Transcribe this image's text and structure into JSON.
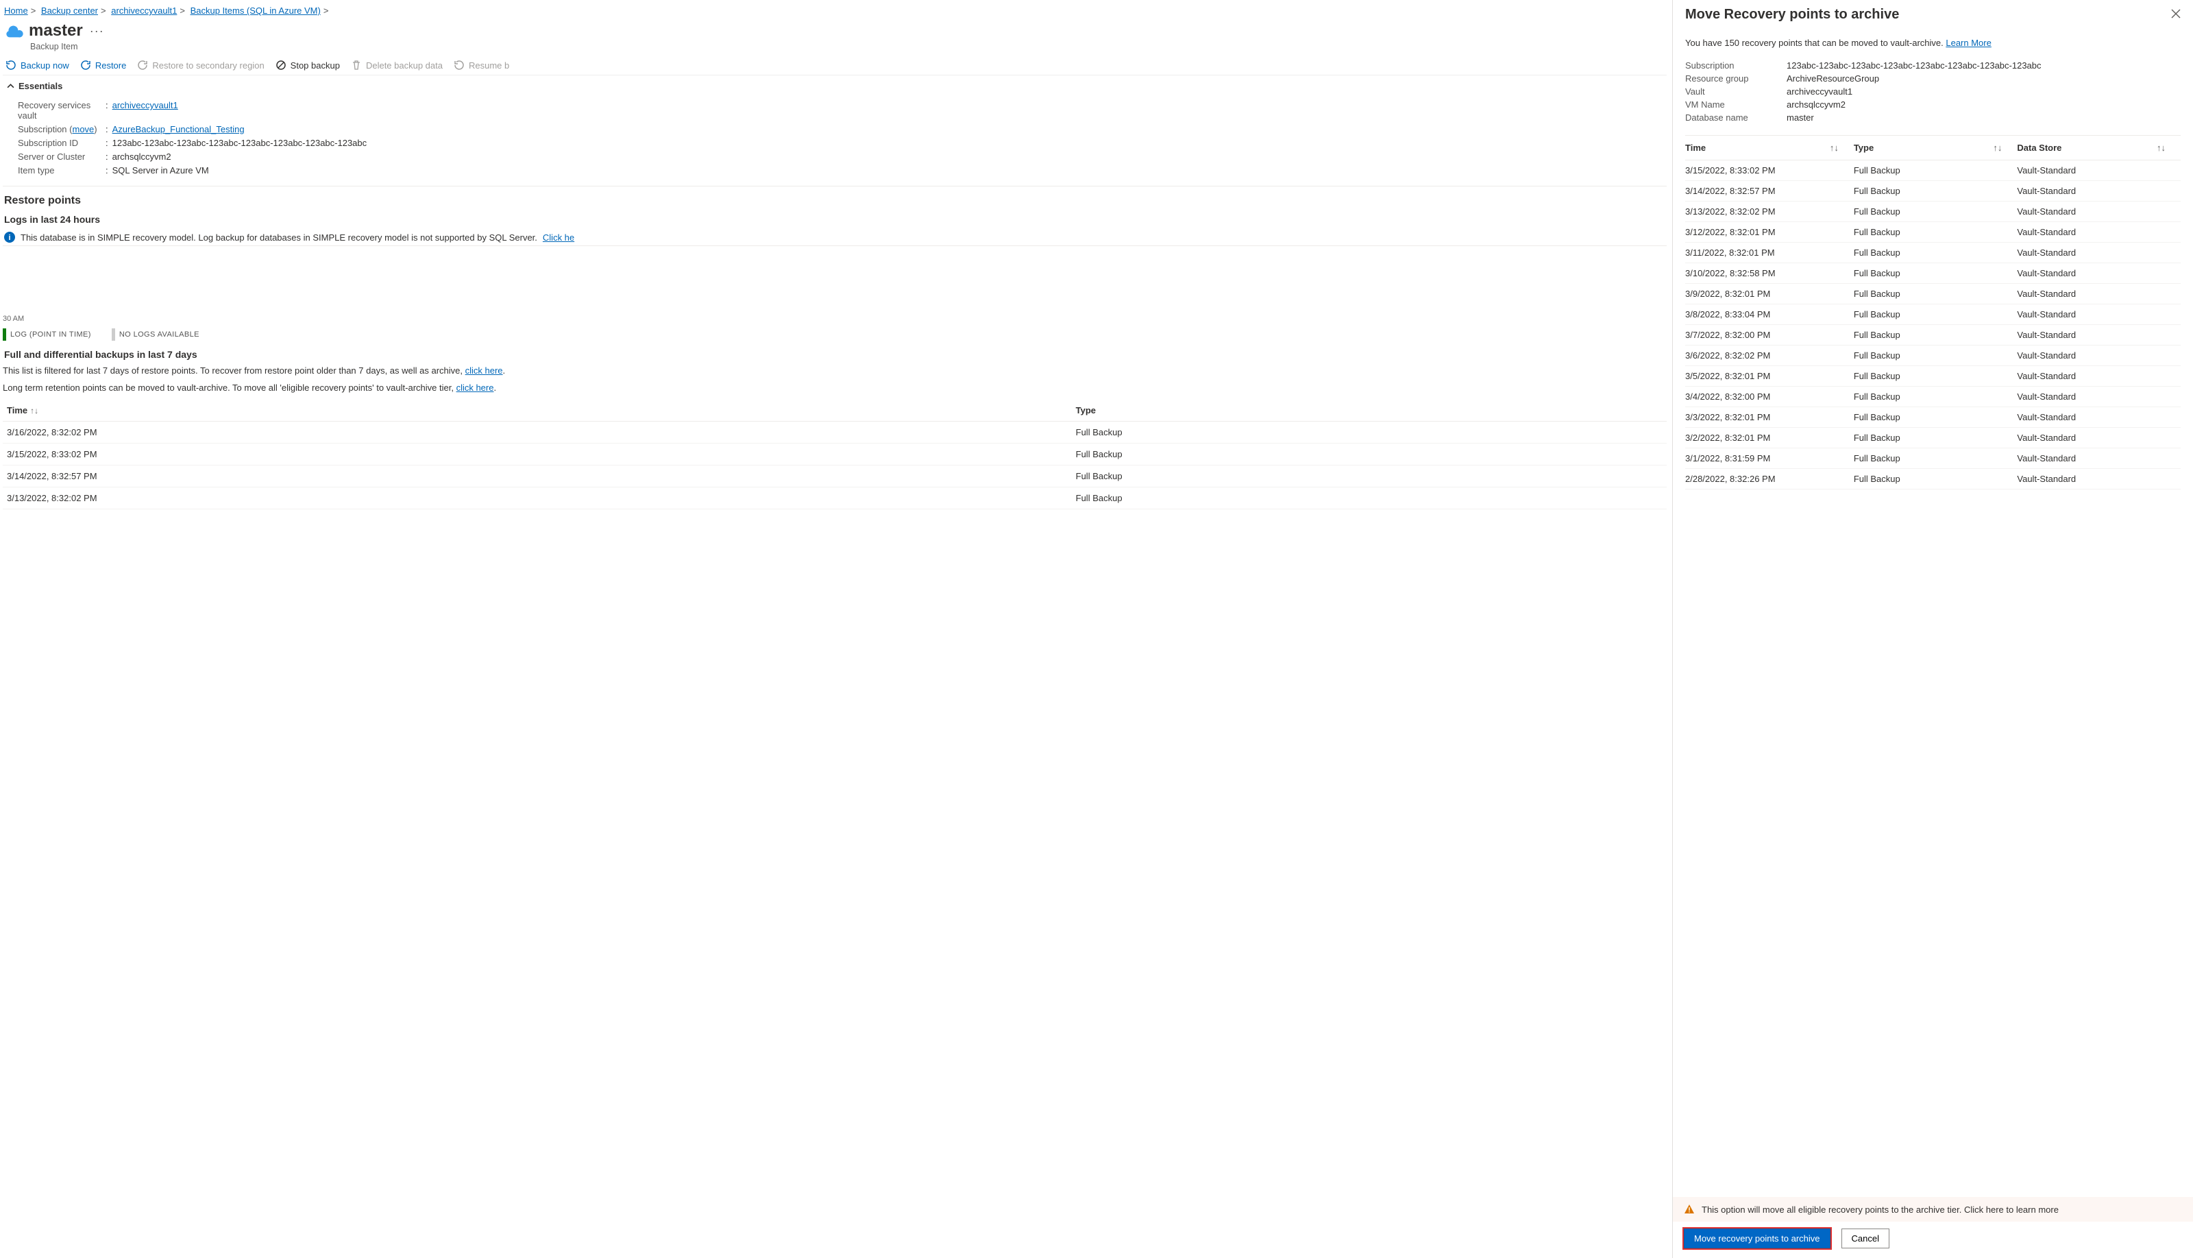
{
  "breadcrumb": [
    {
      "text": "Home",
      "link": true
    },
    {
      "text": "Backup center",
      "link": true
    },
    {
      "text": "archiveccyvault1",
      "link": true
    },
    {
      "text": "Backup Items (SQL in Azure VM)",
      "link": true
    }
  ],
  "page_title": "master",
  "page_subtitle": "Backup Item",
  "toolbar": {
    "backup_now": "Backup now",
    "restore": "Restore",
    "restore_secondary": "Restore to secondary region",
    "stop_backup": "Stop backup",
    "delete_backup": "Delete backup data",
    "resume_backup": "Resume b"
  },
  "essentials_label": "Essentials",
  "essentials": [
    {
      "label": "Recovery services vault",
      "value": "archiveccyvault1",
      "link": true
    },
    {
      "label": "Subscription (",
      "move": "move",
      "label2": ")",
      "value": "AzureBackup_Functional_Testing",
      "link": true
    },
    {
      "label": "Subscription ID",
      "value": "123abc-123abc-123abc-123abc-123abc-123abc-123abc-123abc"
    },
    {
      "label": "Server or Cluster",
      "value": "archsqlccyvm2"
    },
    {
      "label": "Item type",
      "value": "SQL Server in Azure VM"
    }
  ],
  "restore_points_heading": "Restore points",
  "logs_heading": "Logs in last 24 hours",
  "info_banner": {
    "text": "This database is in SIMPLE recovery model. Log backup for databases in SIMPLE recovery model is not supported by SQL Server. ",
    "link": "Click he"
  },
  "timeline": {
    "tick": "30 AM",
    "legend1": "LOG (POINT IN TIME)",
    "legend2": "NO LOGS AVAILABLE"
  },
  "full_backups_heading": "Full and differential backups in last 7 days",
  "filter_desc": {
    "pre": "This list is filtered for last 7 days of restore points. To recover from restore point older than 7 days, as well as archive, ",
    "link": "click here",
    "post": "."
  },
  "archive_desc": {
    "pre": "Long term retention points can be moved to vault-archive. To move all 'eligible recovery points' to vault-archive tier, ",
    "link": "click here",
    "post": "."
  },
  "left_table": {
    "columns": {
      "time": "Time",
      "type": "Type"
    },
    "rows": [
      {
        "time": "3/16/2022, 8:32:02 PM",
        "type": "Full Backup"
      },
      {
        "time": "3/15/2022, 8:33:02 PM",
        "type": "Full Backup"
      },
      {
        "time": "3/14/2022, 8:32:57 PM",
        "type": "Full Backup"
      },
      {
        "time": "3/13/2022, 8:32:02 PM",
        "type": "Full Backup"
      }
    ]
  },
  "panel": {
    "title": "Move Recovery points to archive",
    "desc_pre": "You have 150 recovery points that can be moved to vault-archive. ",
    "desc_link": "Learn More",
    "meta": [
      {
        "k": "Subscription",
        "v": "123abc-123abc-123abc-123abc-123abc-123abc-123abc-123abc"
      },
      {
        "k": "Resource group",
        "v": "ArchiveResourceGroup"
      },
      {
        "k": "Vault",
        "v": "archiveccyvault1"
      },
      {
        "k": "VM Name",
        "v": "archsqlccyvm2"
      },
      {
        "k": "Database name",
        "v": "master"
      }
    ],
    "columns": {
      "time": "Time",
      "type": "Type",
      "store": "Data Store"
    },
    "rows": [
      {
        "time": "3/15/2022, 8:33:02 PM",
        "type": "Full Backup",
        "store": "Vault-Standard"
      },
      {
        "time": "3/14/2022, 8:32:57 PM",
        "type": "Full Backup",
        "store": "Vault-Standard"
      },
      {
        "time": "3/13/2022, 8:32:02 PM",
        "type": "Full Backup",
        "store": "Vault-Standard"
      },
      {
        "time": "3/12/2022, 8:32:01 PM",
        "type": "Full Backup",
        "store": "Vault-Standard"
      },
      {
        "time": "3/11/2022, 8:32:01 PM",
        "type": "Full Backup",
        "store": "Vault-Standard"
      },
      {
        "time": "3/10/2022, 8:32:58 PM",
        "type": "Full Backup",
        "store": "Vault-Standard"
      },
      {
        "time": "3/9/2022, 8:32:01 PM",
        "type": "Full Backup",
        "store": "Vault-Standard"
      },
      {
        "time": "3/8/2022, 8:33:04 PM",
        "type": "Full Backup",
        "store": "Vault-Standard"
      },
      {
        "time": "3/7/2022, 8:32:00 PM",
        "type": "Full Backup",
        "store": "Vault-Standard"
      },
      {
        "time": "3/6/2022, 8:32:02 PM",
        "type": "Full Backup",
        "store": "Vault-Standard"
      },
      {
        "time": "3/5/2022, 8:32:01 PM",
        "type": "Full Backup",
        "store": "Vault-Standard"
      },
      {
        "time": "3/4/2022, 8:32:00 PM",
        "type": "Full Backup",
        "store": "Vault-Standard"
      },
      {
        "time": "3/3/2022, 8:32:01 PM",
        "type": "Full Backup",
        "store": "Vault-Standard"
      },
      {
        "time": "3/2/2022, 8:32:01 PM",
        "type": "Full Backup",
        "store": "Vault-Standard"
      },
      {
        "time": "3/1/2022, 8:31:59 PM",
        "type": "Full Backup",
        "store": "Vault-Standard"
      },
      {
        "time": "2/28/2022, 8:32:26 PM",
        "type": "Full Backup",
        "store": "Vault-Standard"
      }
    ],
    "warn": "This option will move all eligible recovery points to the archive tier. Click here to learn more",
    "primary": "Move recovery points to archive",
    "secondary": "Cancel"
  }
}
